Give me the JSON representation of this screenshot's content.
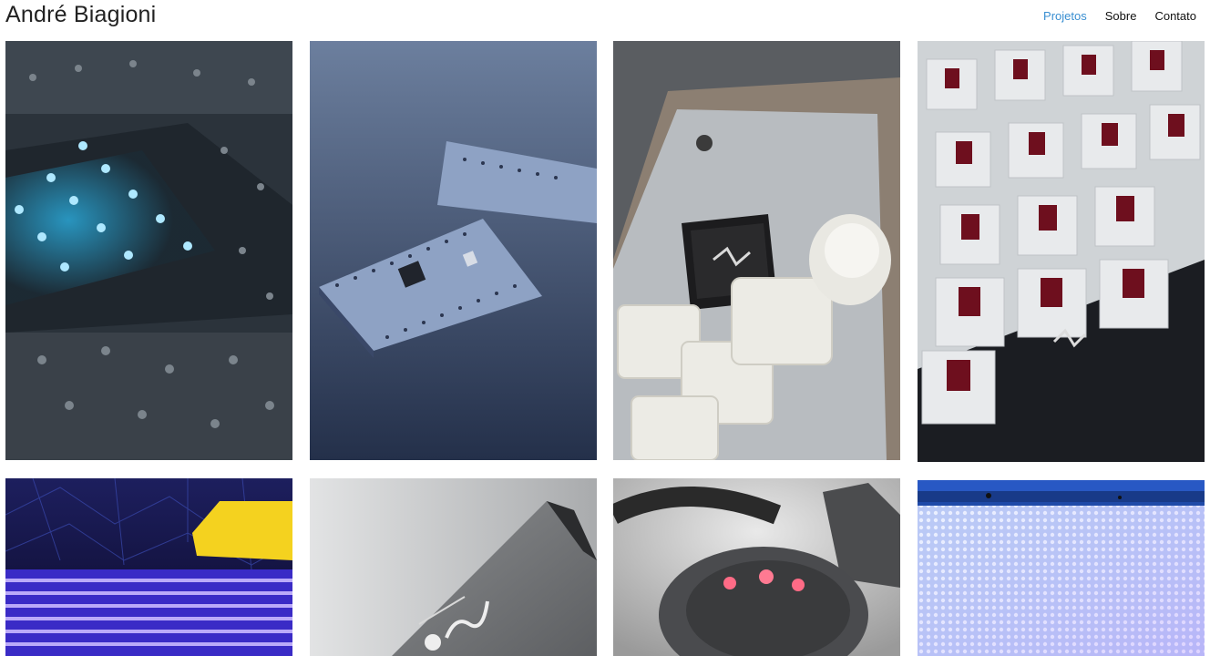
{
  "site": {
    "title": "André Biagioni"
  },
  "nav": {
    "items": [
      {
        "label": "Projetos",
        "active": true
      },
      {
        "label": "Sobre",
        "active": false
      },
      {
        "label": "Contato",
        "active": false
      }
    ],
    "active_color": "#3a8fd1"
  },
  "projects": [
    {
      "image": "led-keyboard-pcb-photo"
    },
    {
      "image": "microcontroller-board-photo"
    },
    {
      "image": "macropad-oled-photo"
    },
    {
      "image": "mechanical-switches-pcb-photo"
    },
    {
      "image": "led-matrix-purple-photo"
    },
    {
      "image": "metal-plaque-osesp-photo"
    },
    {
      "image": "device-red-leds-photo"
    },
    {
      "image": "led-panel-blue-photo"
    }
  ]
}
